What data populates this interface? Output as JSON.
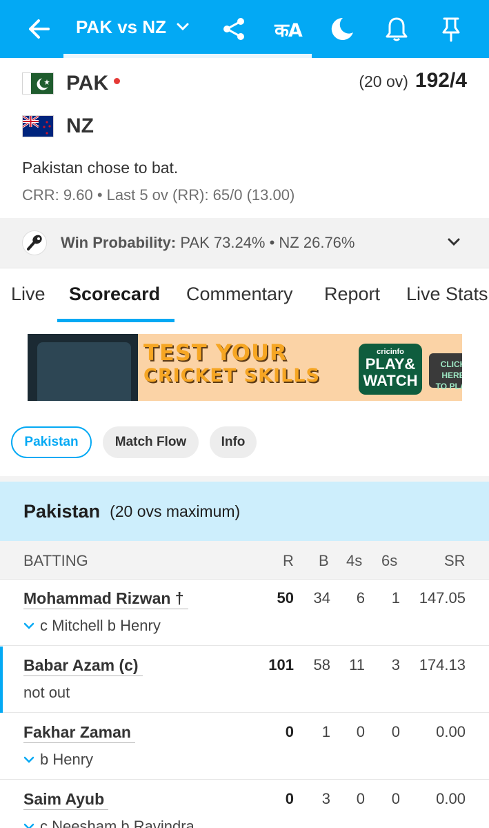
{
  "header": {
    "title": "PAK vs NZ",
    "lang_label": "कA",
    "icons": [
      "back-arrow-icon",
      "chevron-down-icon",
      "share-icon",
      "language-icon",
      "moon-icon",
      "bell-icon",
      "pin-icon"
    ],
    "accent_color": "#03a9f4"
  },
  "score": {
    "team1": {
      "name": "PAK",
      "overs": "(20 ov)",
      "runs": "192/4",
      "live": true
    },
    "team2": {
      "name": "NZ"
    },
    "toss": "Pakistan chose to bat.",
    "crr": "CRR: 9.60 • Last 5 ov (RR): 65/0 (13.00)"
  },
  "win_probability": {
    "label": "Win Probability:",
    "value": "PAK 73.24% • NZ 26.76%"
  },
  "tabs": [
    "Live",
    "Scorecard",
    "Commentary",
    "Report",
    "Live Stats"
  ],
  "active_tab": "Scorecard",
  "ad": {
    "headline_line1": "TEST YOUR",
    "headline_line2": "CRICKET SKILLS",
    "brand": "cricinfo",
    "badge_line1": "PLAY&",
    "badge_line2": "WATCH",
    "cta_line1": "CLICK HERE",
    "cta_line2": "TO PLAY"
  },
  "pills": [
    "Pakistan",
    "Match Flow",
    "Info"
  ],
  "innings": {
    "team": "Pakistan",
    "sub": "(20 ovs maximum)"
  },
  "batting": {
    "headers": [
      "BATTING",
      "R",
      "B",
      "4s",
      "6s",
      "SR"
    ],
    "rows": [
      {
        "name": "Mohammad Rizwan †",
        "dismissal": "c Mitchell b Henry",
        "r": "50",
        "b": "34",
        "fours": "6",
        "sixes": "1",
        "sr": "147.05"
      },
      {
        "name": "Babar Azam (c)",
        "dismissal": "not out",
        "r": "101",
        "b": "58",
        "fours": "11",
        "sixes": "3",
        "sr": "174.13"
      },
      {
        "name": "Fakhar Zaman",
        "dismissal": "b Henry",
        "r": "0",
        "b": "1",
        "fours": "0",
        "sixes": "0",
        "sr": "0.00"
      },
      {
        "name": "Saim Ayub",
        "dismissal": "c Neesham b Ravindra",
        "r": "0",
        "b": "3",
        "fours": "0",
        "sixes": "0",
        "sr": "0.00"
      }
    ]
  }
}
